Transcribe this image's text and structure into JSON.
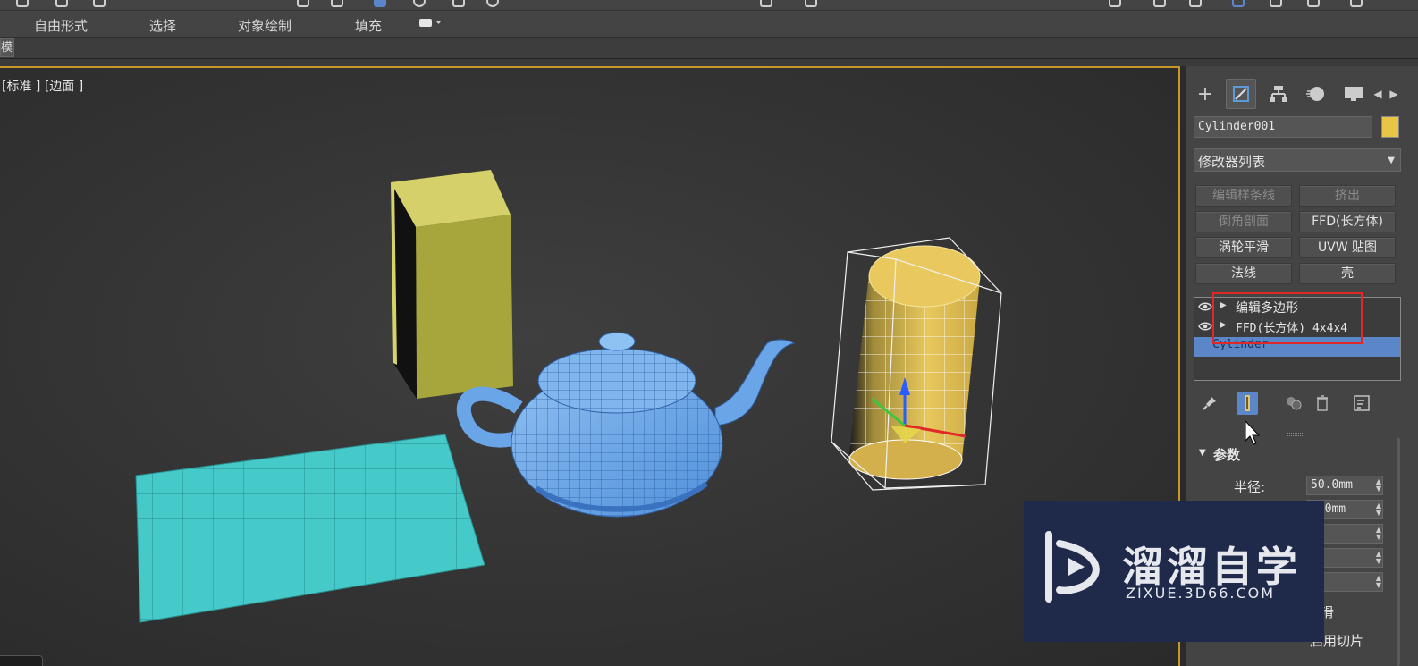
{
  "ribbon": {
    "tabs": [
      "自由形式",
      "选择",
      "对象绘制",
      "填充"
    ],
    "sub_tab": "模"
  },
  "viewport": {
    "label": "[标准 ] [边面 ]"
  },
  "command_panel": {
    "object_name": "Cylinder001",
    "object_color": "#e8c447",
    "modifier_list": "修改器列表",
    "quick_buttons": [
      {
        "label": "编辑样条线",
        "enabled": false
      },
      {
        "label": "挤出",
        "enabled": false
      },
      {
        "label": "倒角剖面",
        "enabled": false
      },
      {
        "label": "FFD(长方体)",
        "enabled": true
      },
      {
        "label": "涡轮平滑",
        "enabled": true
      },
      {
        "label": "UVW 贴图",
        "enabled": true
      },
      {
        "label": "法线",
        "enabled": true
      },
      {
        "label": "壳",
        "enabled": true
      }
    ],
    "stack": {
      "items": [
        "编辑多边形",
        "FFD(长方体) 4x4x4"
      ],
      "base_object": "Cylinder"
    },
    "rollout_title": "参数",
    "params": [
      {
        "label": "半径:",
        "value": "50.0mm"
      },
      {
        "label": "",
        "value": "0.0mm"
      }
    ],
    "checkboxes": [
      "滑",
      "启用切片"
    ]
  },
  "watermark": {
    "title": "溜溜自学",
    "url": "ZIXUE.3D66.COM"
  },
  "colors": {
    "viewport_border": "#c8972c",
    "selection_blue": "#5b86c7",
    "highlight_red": "#e02828",
    "box_yellow": "#c9c85a",
    "teapot_blue": "#6aa5e8",
    "plane_cyan": "#46c9c9",
    "cylinder_gold": "#e3c45a"
  }
}
